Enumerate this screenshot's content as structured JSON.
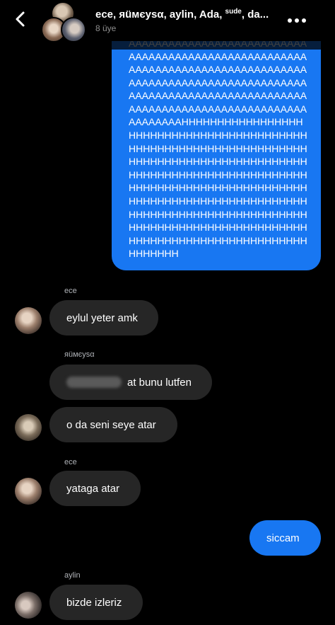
{
  "header": {
    "title_prefix": "ece, яüмєуѕα, aylin, Ada, ",
    "title_sup": "sude",
    "title_suffix": ", da...",
    "member_count": "8 üye",
    "back_icon": "chevron-left-icon",
    "more_icon": "more-dots-icon"
  },
  "big_message": {
    "text": "AAAAAAAAAAAAAAAAAAAAAAAAAAAAAAAAAAAAAAAAAAAAAAAAAAAAAAAAAAAAAAAAAAAAAAAAAAAAAAAAAAAAAAAAAAAAAAAAAAAAAAAAAAAAAAAAAAAAAAAAAAAAAAAAAAAAAAAAAAAAAAAAAAAAAAAAAAAAAAAAAAAAAAAAAAAAAAAAAAAAAAAAAAAAAAAAAAAAAAAAAAAAAAAAAAAAAAAAAAAAAAAAAAAAAAAAAAAAAAAAAAAAAAAAAAAAAAAAAAAAAAAAAAAAAAAAAAAAAAAAAAAAAAAAAAAAAAAAAAAAAAAAAAAAAAAAAAAAAAAAAAAAAAAAAAAAAAAAAAAAAAAAAAAAAAAAAAAAAAAAAAAAAAAAAAAAAAAAAAAAAAAAAAHHHHHHHHHHHHHHHHHHHHHHHHHHHHHHHHHHHHHHHHHHHHHHHHHHHHHHHHHHHHHHHHHHHHHHHHHHHHHHHHHHHHHHHHHHHHHHHHHHHHHHHHHHHHHHHHHHHHHHHHHHHHHHHHHHHHHHHHHHHHHHHHHHHHHHHHHHHHHHHHHHHHHHHHHHHHHHHHHHHHHHHHHHHHHHHHHHHHHHHHHHHHHHHHHHHHHHHHHHHHHHHHHHHHHHHHHHHHHHHHHHHHHHHHH"
  },
  "messages": [
    {
      "sender": "ece",
      "text": "eylul yeter amk"
    },
    {
      "sender": "яüмєуѕα",
      "text": "at bunu lutfen"
    },
    {
      "sender": "",
      "text": "o da seni seye atar"
    },
    {
      "sender": "ece",
      "text": "yataga atar"
    },
    {
      "sender": "",
      "text": "siccam"
    },
    {
      "sender": "aylin",
      "text": "bizde izleriz"
    }
  ]
}
